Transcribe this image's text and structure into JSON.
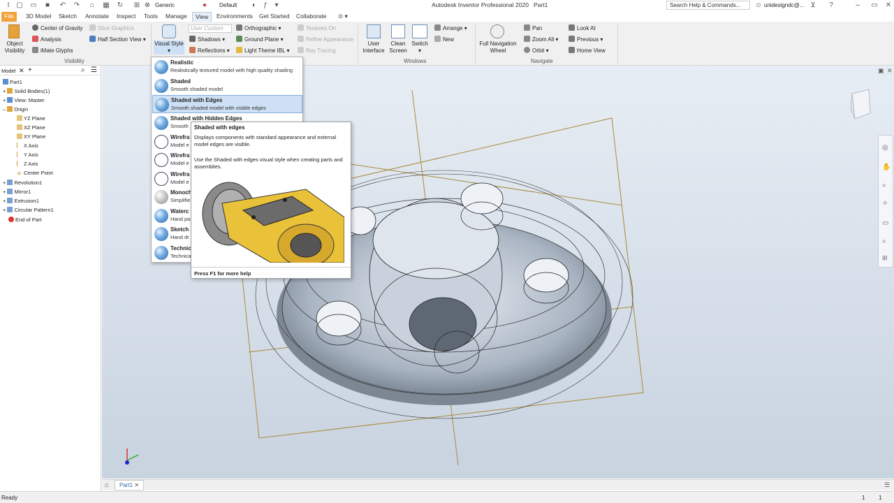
{
  "app": {
    "title": "Autodesk Inventor Professional 2020",
    "document": "Part1",
    "search_placeholder": "Search Help & Commands...",
    "user": "unidesigndc@...",
    "appearance": "Generic",
    "material": "Default"
  },
  "tabs": [
    "File",
    "3D Model",
    "Sketch",
    "Annotate",
    "Inspect",
    "Tools",
    "Manage",
    "View",
    "Environments",
    "Get Started",
    "Collaborate"
  ],
  "ribbon": {
    "visibility": {
      "object_visibility": "Object Visibility",
      "center_of_gravity": "Center of Gravity",
      "slice_graphics": "Slice Graphics",
      "analysis": "Analysis",
      "half_section_view": "Half Section View",
      "imate_glyphs": "iMate Glyphs",
      "label": "Visibility"
    },
    "appearance": {
      "visual_style": "Visual Style",
      "user_custom": "User Custom",
      "orthographic": "Orthographic",
      "textures_on": "Textures On",
      "shadows": "Shadows",
      "ground_plane": "Ground Plane",
      "refine_appearance": "Refine Appearance",
      "reflections": "Reflections",
      "light_theme": "Light Theme IBL",
      "ray_tracing": "Ray Tracing"
    },
    "windows": {
      "user_interface": "User Interface",
      "clean_screen": "Clean Screen",
      "switch": "Switch",
      "arrange": "Arrange",
      "new": "New",
      "label": "Windows"
    },
    "navigate": {
      "full_nav_wheel": "Full Navigation Wheel",
      "pan": "Pan",
      "zoom_all": "Zoom All",
      "orbit": "Orbit",
      "look_at": "Look At",
      "previous": "Previous",
      "home_view": "Home View",
      "label": "Navigate"
    }
  },
  "browser": {
    "tab": "Model",
    "items": [
      "Part1",
      "Solid Bodies(1)",
      "View: Master",
      "Origin",
      "YZ Plane",
      "XZ Plane",
      "XY Plane",
      "X Axis",
      "Y Axis",
      "Z Axis",
      "Center Point",
      "Revolution1",
      "Mirror1",
      "Extrusion1",
      "Circular Pattern1",
      "End of Part"
    ]
  },
  "visual_styles": [
    {
      "name": "Realistic",
      "desc": "Realistically textured model with high quality shading"
    },
    {
      "name": "Shaded",
      "desc": "Smooth shaded model"
    },
    {
      "name": "Shaded with Edges",
      "desc": "Smooth shaded model with visible edges"
    },
    {
      "name": "Shaded with Hidden Edges",
      "desc": "Smooth"
    },
    {
      "name": "Wirefra",
      "desc": "Model e"
    },
    {
      "name": "Wirefra",
      "desc": "Model e"
    },
    {
      "name": "Wirefra",
      "desc": "Model e"
    },
    {
      "name": "Monoch",
      "desc": "Simplifie"
    },
    {
      "name": "Waterc",
      "desc": "Hand pa"
    },
    {
      "name": "Sketch I",
      "desc": "Hand dr"
    },
    {
      "name": "Technica",
      "desc": "Technica"
    }
  ],
  "tooltip": {
    "title": "Shaded with edges",
    "line1": "Displays components with standard appearance and external model edges are visible.",
    "line2": "Use the Shaded with edges visual style when creating parts and assemblies.",
    "footer": "Press F1 for more help"
  },
  "doc_tab": "Part1",
  "status": {
    "left": "Ready",
    "page": "1",
    "count": "1"
  },
  "colors": {
    "file_tab": "#f2a23a",
    "selected": "#cde0f5",
    "accent": "#2d6aa8"
  }
}
